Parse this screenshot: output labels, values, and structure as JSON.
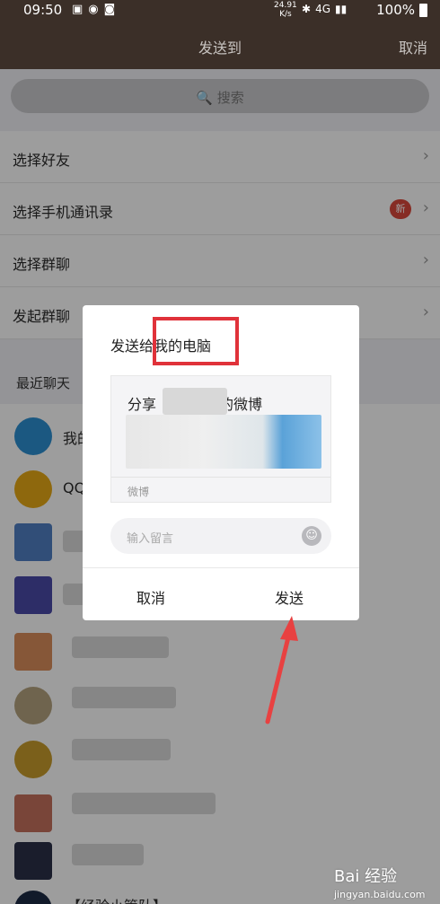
{
  "status_bar": {
    "time": "09:50",
    "speed": "24.91\nK/s",
    "battery": "100%",
    "icons": [
      "image-icon",
      "globe-icon",
      "wifi-icon",
      "bluetooth-icon",
      "lte-icon",
      "signal-icon",
      "battery-icon"
    ]
  },
  "header": {
    "title": "发送到",
    "cancel": "取消"
  },
  "search": {
    "placeholder": "🔍 搜索"
  },
  "menu": {
    "items": [
      {
        "label": "选择好友"
      },
      {
        "label": "选择手机通讯录",
        "badge": "新"
      },
      {
        "label": "选择群聊"
      },
      {
        "label": "发起群聊"
      }
    ],
    "chevron": "›"
  },
  "recent": {
    "header": "最近聊天",
    "rows": [
      {
        "name": "我的"
      },
      {
        "name": "QQ"
      },
      {
        "name": ""
      },
      {
        "name": ""
      },
      {
        "name": ""
      },
      {
        "name": ""
      },
      {
        "name": ""
      },
      {
        "name": ""
      },
      {
        "name": ""
      },
      {
        "name": "【经验小管队】"
      }
    ]
  },
  "dialog": {
    "to_prefix": "发送给",
    "to_target": "我的电脑",
    "card_share_prefix": "分享",
    "card_share_suffix": "的微博",
    "card_source": "微博",
    "message_placeholder": "输入留言",
    "cancel": "取消",
    "send": "发送"
  },
  "watermark": {
    "brand": "Bai 经验",
    "url": "jingyan.baidu.com"
  },
  "colors": {
    "titlebar": "#3b2f28",
    "highlight": "#e0323a",
    "badge": "#d9473b"
  }
}
